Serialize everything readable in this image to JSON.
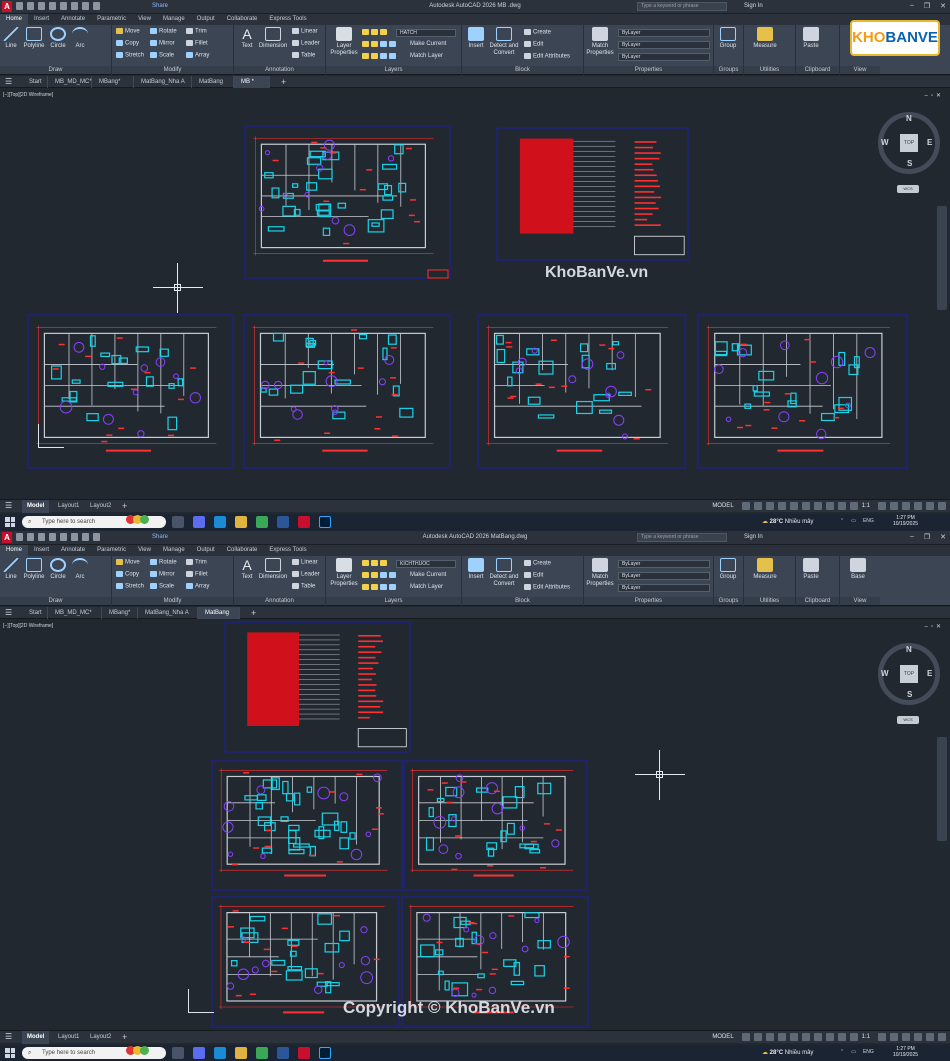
{
  "windows": [
    {
      "title": "Autodesk AutoCAD 2026   MB .dwg",
      "share": "Share",
      "search_placeholder": "Type a keyword or phrase",
      "sign_in": "Sign In",
      "ribbon_tabs": [
        "Home",
        "Insert",
        "Annotate",
        "Parametric",
        "View",
        "Manage",
        "Output",
        "Collaborate",
        "Express Tools"
      ],
      "layer_combo": "HATCH",
      "doc_tabs": [
        "Start",
        "MB_MD_MC*",
        "MBang*",
        "MatBang_Nha A",
        "MatBang",
        "MB *"
      ],
      "active_doc_tab": "MB *",
      "viewport_label": "[−][Top][2D Wireframe]",
      "layout_tabs": [
        "Model",
        "Layout1",
        "Layout2"
      ],
      "status_model": "MODEL",
      "status_scale": "1:1"
    },
    {
      "title": "Autodesk AutoCAD 2026   MatBang.dwg",
      "share": "Share",
      "search_placeholder": "Type a keyword or phrase",
      "sign_in": "Sign In",
      "ribbon_tabs": [
        "Home",
        "Insert",
        "Annotate",
        "Parametric",
        "View",
        "Manage",
        "Output",
        "Collaborate",
        "Express Tools"
      ],
      "layer_combo": "KICHTHUOC",
      "doc_tabs": [
        "Start",
        "MB_MD_MC*",
        "MBang*",
        "MatBang_Nha A",
        "MatBang"
      ],
      "active_doc_tab": "MatBang",
      "viewport_label": "[−][Top][2D Wireframe]",
      "layout_tabs": [
        "Model",
        "Layout1",
        "Layout2"
      ],
      "status_model": "MODEL",
      "status_scale": "1:1"
    }
  ],
  "ribbon": {
    "draw": {
      "title": "Draw",
      "line": "Line",
      "polyline": "Polyline",
      "circle": "Circle",
      "arc": "Arc"
    },
    "modify": {
      "title": "Modify",
      "move": "Move",
      "rotate": "Rotate",
      "trim": "Trim",
      "copy": "Copy",
      "mirror": "Mirror",
      "fillet": "Fillet",
      "stretch": "Stretch",
      "scale": "Scale",
      "array": "Array"
    },
    "annotation": {
      "title": "Annotation",
      "text": "Text",
      "dimension": "Dimension",
      "linear": "Linear",
      "leader": "Leader",
      "table": "Table"
    },
    "layers": {
      "title": "Layers",
      "layer_properties": "Layer Properties",
      "make_current": "Make Current",
      "match_layer": "Match Layer"
    },
    "block": {
      "title": "Block",
      "insert": "Insert",
      "detect": "Detect and Convert",
      "create": "Create",
      "edit": "Edit",
      "edit_attributes": "Edit Attributes"
    },
    "properties": {
      "title": "Properties",
      "match": "Match Properties",
      "bylayer": "ByLayer"
    },
    "groups": {
      "title": "Groups",
      "group": "Group"
    },
    "utilities": {
      "title": "Utilities",
      "measure": "Measure"
    },
    "clipboard": {
      "title": "Clipboard",
      "paste": "Paste"
    },
    "view": {
      "title": "View",
      "base": "Base"
    }
  },
  "viewcube": {
    "top": "TOP",
    "n": "N",
    "s": "S",
    "e": "E",
    "w": "W",
    "wcs": "WCS"
  },
  "taskbar": {
    "search": "Type here to search",
    "weather": "28°C",
    "weather_desc": "Nhiều mây",
    "lang": "ENG",
    "time": "1:27 PM",
    "date": "10/19/2025"
  },
  "watermarks": {
    "site": "KhoBanVe.vn",
    "copyright": "Copyright © KhoBanVe.vn",
    "logo_a": "KHO",
    "logo_b": "BANVE"
  },
  "colors": {
    "accent": "#c8102e",
    "linework": "#ff3030",
    "furniture": "#19d4e8",
    "frame": "#1d1ea6",
    "purple": "#8a40ff"
  }
}
